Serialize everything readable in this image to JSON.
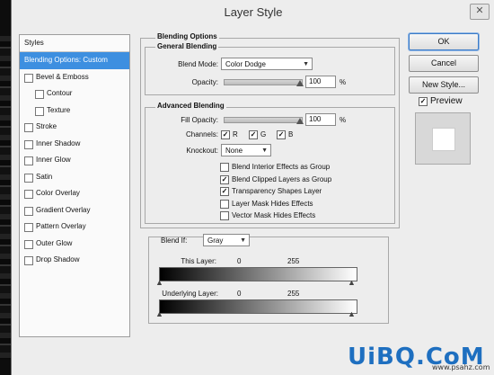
{
  "dialog": {
    "title": "Layer Style"
  },
  "styles_panel": {
    "header": "Styles",
    "items": [
      {
        "label": "Blending Options: Custom",
        "selected": true
      },
      {
        "label": "Bevel & Emboss",
        "checked": false,
        "level": 1
      },
      {
        "label": "Contour",
        "checked": false,
        "level": 2
      },
      {
        "label": "Texture",
        "checked": false,
        "level": 2
      },
      {
        "label": "Stroke",
        "checked": false,
        "level": 1
      },
      {
        "label": "Inner Shadow",
        "checked": false,
        "level": 1
      },
      {
        "label": "Inner Glow",
        "checked": false,
        "level": 1
      },
      {
        "label": "Satin",
        "checked": false,
        "level": 1
      },
      {
        "label": "Color Overlay",
        "checked": false,
        "level": 1
      },
      {
        "label": "Gradient Overlay",
        "checked": false,
        "level": 1
      },
      {
        "label": "Pattern Overlay",
        "checked": false,
        "level": 1
      },
      {
        "label": "Outer Glow",
        "checked": false,
        "level": 1
      },
      {
        "label": "Drop Shadow",
        "checked": false,
        "level": 1
      }
    ]
  },
  "blending_options": {
    "title": "Blending Options",
    "general": {
      "title": "General Blending",
      "blend_mode_label": "Blend Mode:",
      "blend_mode_value": "Color Dodge",
      "opacity_label": "Opacity:",
      "opacity_value": "100",
      "opacity_unit": "%"
    },
    "advanced": {
      "title": "Advanced Blending",
      "fill_opacity_label": "Fill Opacity:",
      "fill_opacity_value": "100",
      "fill_opacity_unit": "%",
      "channels_label": "Channels:",
      "channel_r": "R",
      "channel_g": "G",
      "channel_b": "B",
      "knockout_label": "Knockout:",
      "knockout_value": "None",
      "options": [
        {
          "label": "Blend Interior Effects as Group",
          "checked": false
        },
        {
          "label": "Blend Clipped Layers as Group",
          "checked": true
        },
        {
          "label": "Transparency Shapes Layer",
          "checked": true
        },
        {
          "label": "Layer Mask Hides Effects",
          "checked": false
        },
        {
          "label": "Vector Mask Hides Effects",
          "checked": false
        }
      ]
    },
    "blend_if": {
      "label": "Blend If:",
      "value": "Gray",
      "this_layer_label": "This Layer:",
      "this_layer_min": "0",
      "this_layer_max": "255",
      "underlying_label": "Underlying Layer:",
      "underlying_min": "0",
      "underlying_max": "255"
    }
  },
  "buttons": {
    "ok": "OK",
    "cancel": "Cancel",
    "new_style": "New Style...",
    "preview": "Preview"
  },
  "watermark": {
    "brand": "UiBQ.CoM",
    "url": "www.psahz.com"
  },
  "colors": {
    "selection": "#3d8fe0",
    "dialog_bg": "#ededed"
  }
}
